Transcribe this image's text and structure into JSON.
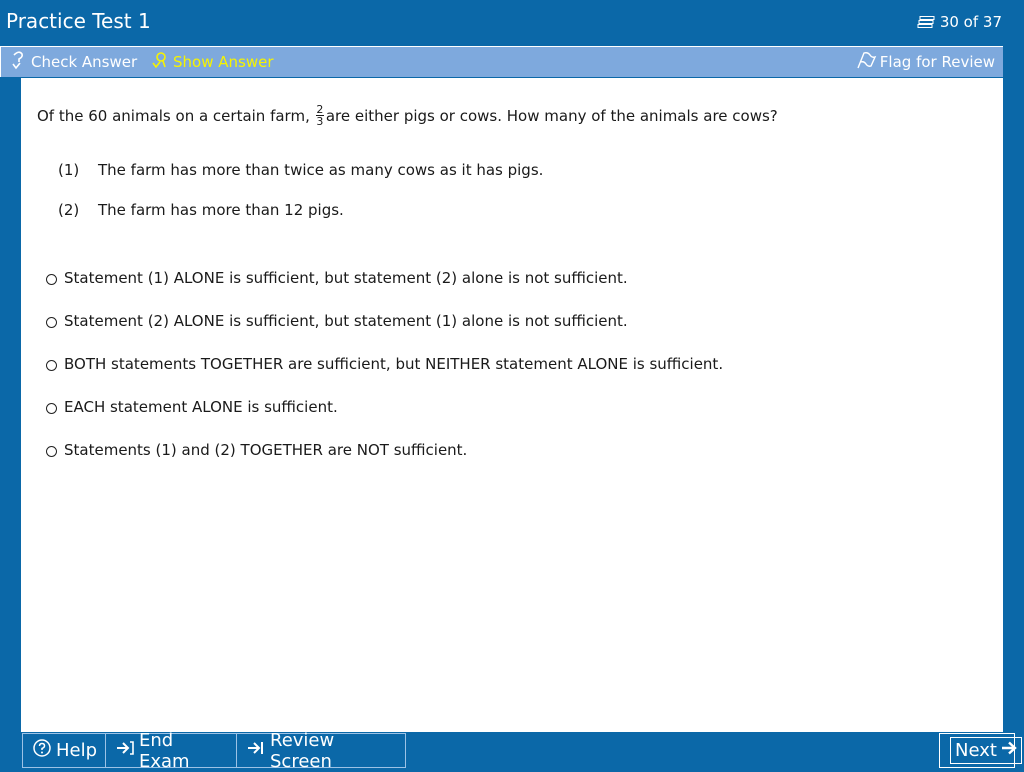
{
  "header": {
    "title": "Practice Test 1",
    "progress_text": "30 of 37",
    "background": "#0b68a8"
  },
  "toolbar": {
    "check_answer": "Check Answer",
    "show_answer": "Show Answer",
    "flag_for_review": "Flag for Review",
    "highlight_color": "#f6f300",
    "background": "#7ea9dd"
  },
  "question": {
    "stem_before": "Of the 60 animals on a certain farm,",
    "fraction_numerator": "2",
    "fraction_denominator": "3",
    "stem_after": "are either pigs or cows.  How many of the animals are cows?",
    "statements": [
      {
        "num": "(1)",
        "text": "The farm has more than twice as many cows as it has pigs."
      },
      {
        "num": "(2)",
        "text": "The farm has more than 12 pigs."
      }
    ],
    "choices": [
      "Statement (1) ALONE is sufficient, but statement (2) alone is not sufficient.",
      "Statement (2) ALONE is sufficient, but statement (1) alone is not sufficient.",
      "BOTH statements TOGETHER are sufficient, but NEITHER statement ALONE is sufficient.",
      "EACH statement ALONE is sufficient.",
      "Statements (1) and (2) TOGETHER are NOT sufficient."
    ]
  },
  "footer": {
    "help": "Help",
    "end_exam": "End Exam",
    "review_screen": "Review Screen",
    "next": "Next"
  }
}
